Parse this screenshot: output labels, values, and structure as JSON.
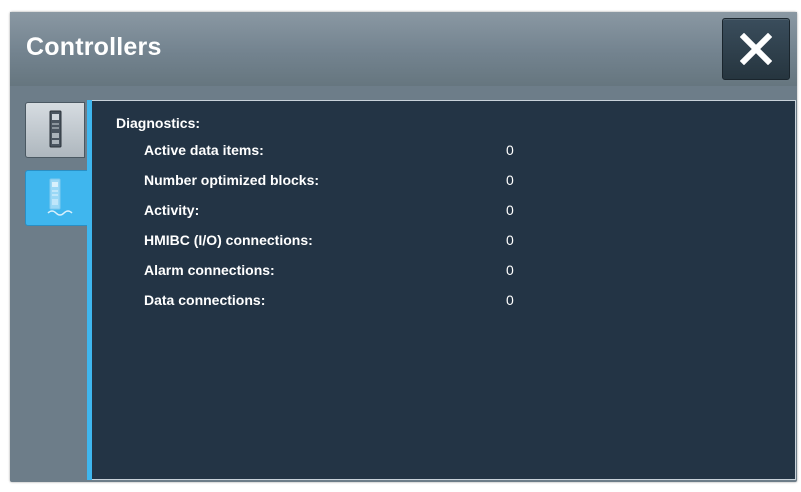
{
  "window": {
    "title": "Controllers",
    "close_icon": "close-x-icon"
  },
  "tabs": [
    {
      "name": "controllers",
      "icon": "controller-device-icon",
      "selected": false
    },
    {
      "name": "diagnostics",
      "icon": "controller-diagnostics-icon",
      "selected": true
    }
  ],
  "diagnostics": {
    "heading": "Diagnostics:",
    "rows": [
      {
        "label": "Active data items:",
        "value": "0"
      },
      {
        "label": "Number optimized blocks:",
        "value": "0"
      },
      {
        "label": "Activity:",
        "value": "0"
      },
      {
        "label": "HMIBC (I/O) connections:",
        "value": "0"
      },
      {
        "label": "Alarm connections:",
        "value": "0"
      },
      {
        "label": "Data connections:",
        "value": "0"
      }
    ]
  },
  "colors": {
    "titlebar": "#73838f",
    "panel": "#233445",
    "accent": "#3fb6ee",
    "close_button": "#2c3d4a"
  }
}
